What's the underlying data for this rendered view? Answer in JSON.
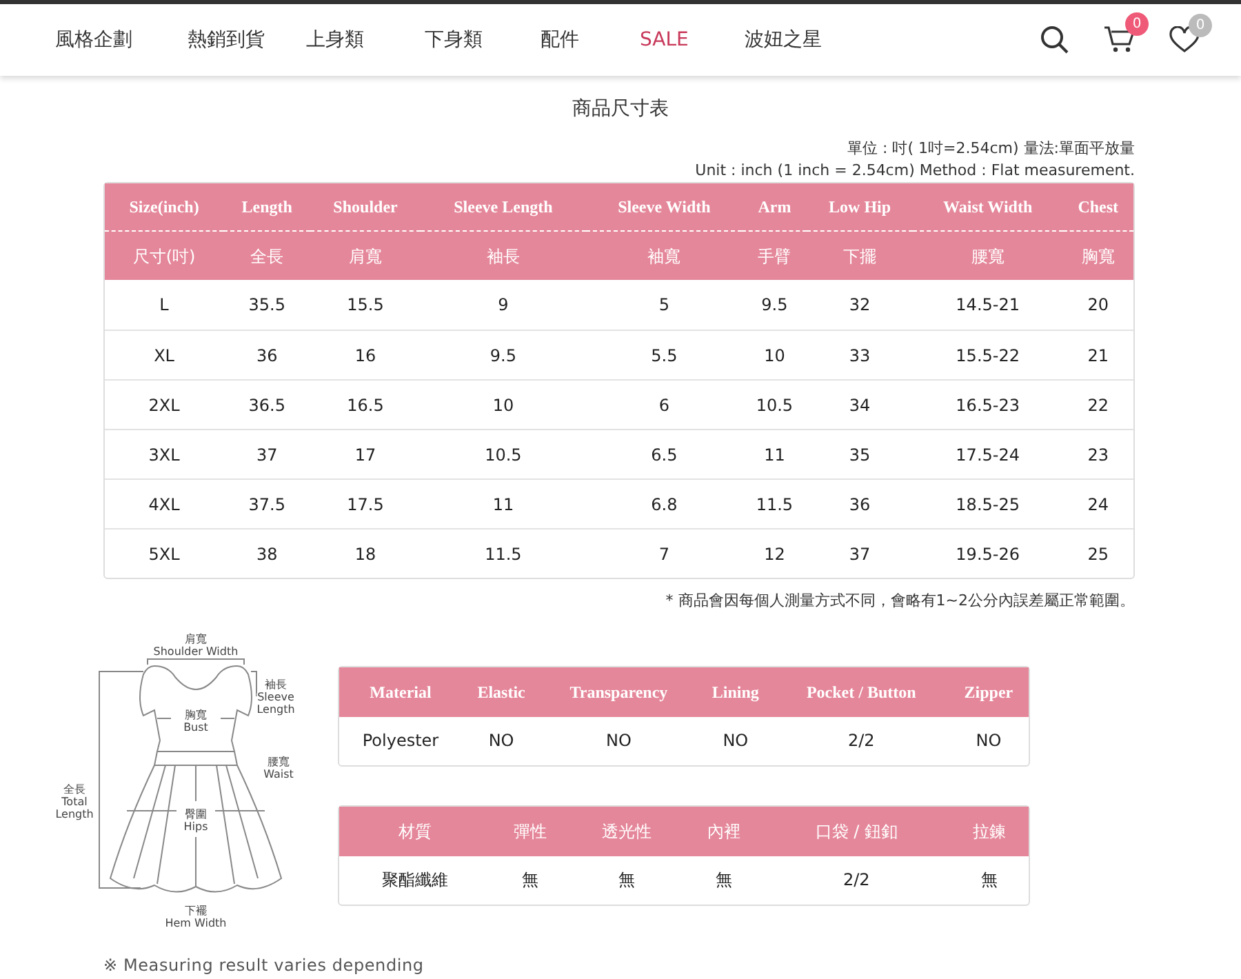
{
  "nav": {
    "items": [
      {
        "label": "風格企劃",
        "kind": "normal"
      },
      {
        "label": "熱銷到貨",
        "kind": "normal"
      },
      {
        "label": "上身類",
        "kind": "normal"
      },
      {
        "label": "下身類",
        "kind": "normal"
      },
      {
        "label": "配件",
        "kind": "normal"
      },
      {
        "label": "SALE",
        "kind": "sale"
      },
      {
        "label": "波妞之星",
        "kind": "normal"
      }
    ],
    "cart_count": "0",
    "wishlist_count": "0"
  },
  "heading": {
    "subtitle": "商品尺寸表"
  },
  "unit_note": [
    "單位 : 吋( 1吋=2.54cm) 量法:單面平放量",
    "Unit : inch (1 inch = 2.54cm) Method : Flat measurement."
  ],
  "size_table": {
    "columns_en": [
      "Size(inch)",
      "Length",
      "Shoulder",
      "Sleeve Length",
      "Sleeve Width",
      "Arm",
      "Low Hip",
      "Waist Width",
      "Chest"
    ],
    "columns_zh": [
      "尺寸(吋)",
      "全長",
      "肩寬",
      "袖長",
      "袖寬",
      "手臂",
      "下擺",
      "腰寬",
      "胸寬"
    ],
    "rows": [
      [
        "L",
        "35.5",
        "15.5",
        "9",
        "5",
        "9.5",
        "32",
        "14.5-21",
        "20"
      ],
      [
        "XL",
        "36",
        "16",
        "9.5",
        "5.5",
        "10",
        "33",
        "15.5-22",
        "21"
      ],
      [
        "2XL",
        "36.5",
        "16.5",
        "10",
        "6",
        "10.5",
        "34",
        "16.5-23",
        "22"
      ],
      [
        "3XL",
        "37",
        "17",
        "10.5",
        "6.5",
        "11",
        "35",
        "17.5-24",
        "23"
      ],
      [
        "4XL",
        "37.5",
        "17.5",
        "11",
        "6.8",
        "11.5",
        "36",
        "18.5-25",
        "24"
      ],
      [
        "5XL",
        "38",
        "18",
        "11.5",
        "7",
        "12",
        "37",
        "19.5-26",
        "25"
      ]
    ]
  },
  "tolerance_note": "* 商品會因每個人測量方式不同，會略有1~2公分內誤差屬正常範圍。",
  "diagram": {
    "labels": [
      [
        "肩寬",
        "Shoulder Width"
      ],
      [
        "袖長",
        "Sleeve",
        "Length"
      ],
      [
        "胸寬",
        "Bust"
      ],
      [
        "腰寬",
        "Waist"
      ],
      [
        "全長",
        "Total",
        "Length"
      ],
      [
        "臀圍",
        "Hips"
      ],
      [
        "下襬",
        "Hem Width"
      ]
    ]
  },
  "material_tables": [
    {
      "kind": "english",
      "columns": [
        "Material",
        "Elastic",
        "Transparency",
        "Lining",
        "Pocket / Button",
        "Zipper"
      ],
      "row": [
        "Polyester",
        "NO",
        "NO",
        "NO",
        "2/2",
        "NO"
      ]
    },
    {
      "kind": "chinese",
      "columns": [
        "材質",
        "彈性",
        "透光性",
        "內裡",
        "口袋 / 鈕釦",
        "拉鍊"
      ],
      "row": [
        "聚酯纖維",
        "無",
        "無",
        "無",
        "2/2",
        "無"
      ]
    }
  ],
  "bottom_note": "※ Measuring result varies depending"
}
